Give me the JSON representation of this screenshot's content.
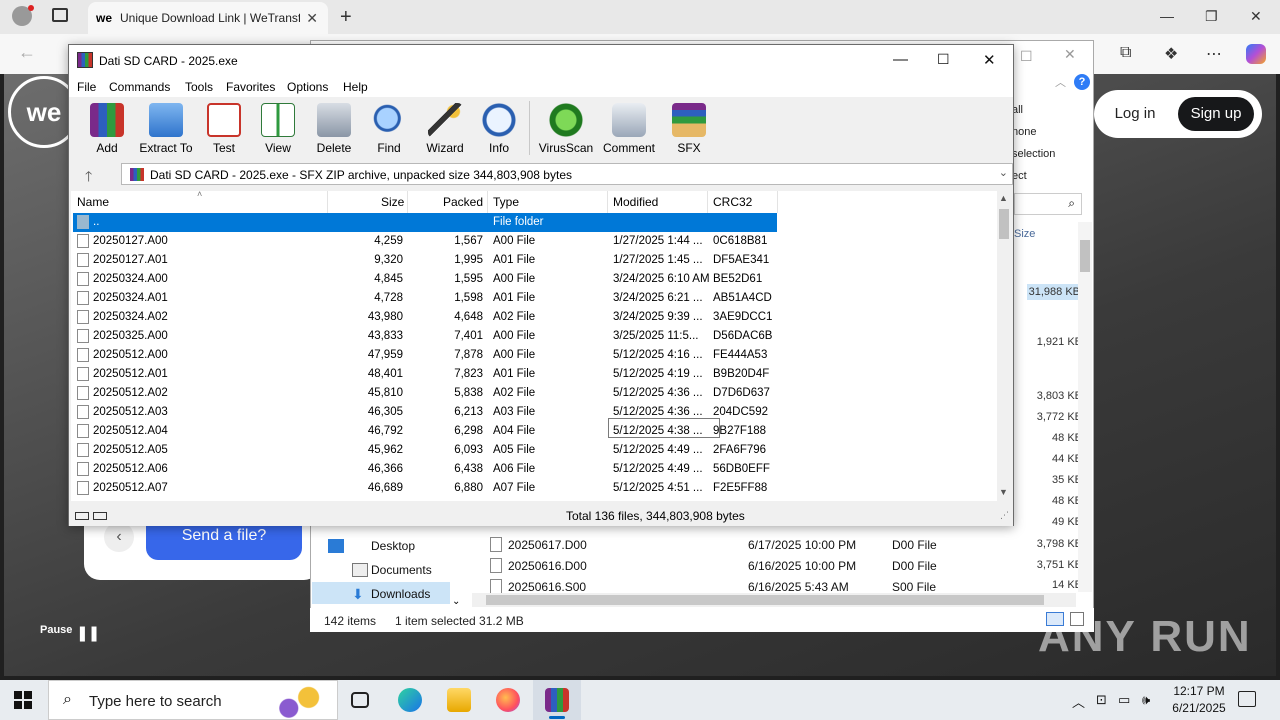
{
  "browser": {
    "tab_title": "Unique Download Link | WeTransf",
    "tab_favicon": "we",
    "new_tab": "+",
    "close_tab": "✕",
    "min": "—",
    "max": "❐",
    "close": "✕"
  },
  "website": {
    "logo": "we",
    "login": "Log in",
    "signup": "Sign up",
    "send_file": "Send a file?",
    "back": "‹",
    "pause": "Pause",
    "pause_icon": "❚❚",
    "watermark": "ANY RUN"
  },
  "explorer": {
    "right_labels": [
      "all",
      "none",
      "selection",
      "ect"
    ],
    "size_header": "Size",
    "sizes": [
      "31,988 KB",
      "1,921 KB",
      "3,803 KB",
      "3,772 KB",
      "48 KB",
      "44 KB",
      "35 KB",
      "48 KB",
      "49 KB",
      "3,798 KB",
      "3,751 KB",
      "14 KB"
    ],
    "nav": [
      "Desktop",
      "Documents",
      "Downloads"
    ],
    "files": [
      {
        "name": "20250617.D00",
        "modified": "6/17/2025 10:00 PM",
        "type": "D00 File"
      },
      {
        "name": "20250616.D00",
        "modified": "6/16/2025 10:00 PM",
        "type": "D00 File"
      },
      {
        "name": "20250616.S00",
        "modified": "6/16/2025 5:43 AM",
        "type": "S00 File"
      }
    ],
    "status_items": "142 items",
    "status_selected": "1 item selected  31.2 MB"
  },
  "winrar": {
    "title": "Dati SD CARD - 2025.exe",
    "menu": [
      "File",
      "Commands",
      "Tools",
      "Favorites",
      "Options",
      "Help"
    ],
    "tools": [
      "Add",
      "Extract To",
      "Test",
      "View",
      "Delete",
      "Find",
      "Wizard",
      "Info",
      "VirusScan",
      "Comment",
      "SFX"
    ],
    "path": "Dati SD CARD - 2025.exe - SFX ZIP archive, unpacked size 344,803,908 bytes",
    "columns": [
      "Name",
      "Size",
      "Packed",
      "Type",
      "Modified",
      "CRC32"
    ],
    "parent_row": {
      "name": "..",
      "type": "File folder"
    },
    "rows": [
      {
        "name": "20250127.A00",
        "size": "4,259",
        "packed": "1,567",
        "type": "A00 File",
        "modified": "1/27/2025 1:44 ...",
        "crc": "0C618B81"
      },
      {
        "name": "20250127.A01",
        "size": "9,320",
        "packed": "1,995",
        "type": "A01 File",
        "modified": "1/27/2025 1:45 ...",
        "crc": "DF5AE341"
      },
      {
        "name": "20250324.A00",
        "size": "4,845",
        "packed": "1,595",
        "type": "A00 File",
        "modified": "3/24/2025 6:10 AM",
        "crc": "BE52D61"
      },
      {
        "name": "20250324.A01",
        "size": "4,728",
        "packed": "1,598",
        "type": "A01 File",
        "modified": "3/24/2025 6:21 ...",
        "crc": "AB51A4CD"
      },
      {
        "name": "20250324.A02",
        "size": "43,980",
        "packed": "4,648",
        "type": "A02 File",
        "modified": "3/24/2025 9:39 ...",
        "crc": "3AE9DCC1"
      },
      {
        "name": "20250325.A00",
        "size": "43,833",
        "packed": "7,401",
        "type": "A00 File",
        "modified": "3/25/2025 11:5...",
        "crc": "D56DAC6B"
      },
      {
        "name": "20250512.A00",
        "size": "47,959",
        "packed": "7,878",
        "type": "A00 File",
        "modified": "5/12/2025 4:16 ...",
        "crc": "FE444A53"
      },
      {
        "name": "20250512.A01",
        "size": "48,401",
        "packed": "7,823",
        "type": "A01 File",
        "modified": "5/12/2025 4:19 ...",
        "crc": "B9B20D4F"
      },
      {
        "name": "20250512.A02",
        "size": "45,810",
        "packed": "5,838",
        "type": "A02 File",
        "modified": "5/12/2025 4:36 ...",
        "crc": "D7D6D637"
      },
      {
        "name": "20250512.A03",
        "size": "46,305",
        "packed": "6,213",
        "type": "A03 File",
        "modified": "5/12/2025 4:36 ...",
        "crc": "204DC592"
      },
      {
        "name": "20250512.A04",
        "size": "46,792",
        "packed": "6,298",
        "type": "A04 File",
        "modified": "5/12/2025 4:38 ...",
        "crc": "9B27F188"
      },
      {
        "name": "20250512.A05",
        "size": "45,962",
        "packed": "6,093",
        "type": "A05 File",
        "modified": "5/12/2025 4:49 ...",
        "crc": "2FA6F796"
      },
      {
        "name": "20250512.A06",
        "size": "46,366",
        "packed": "6,438",
        "type": "A06 File",
        "modified": "5/12/2025 4:49 ...",
        "crc": "56DB0EFF"
      },
      {
        "name": "20250512.A07",
        "size": "46,689",
        "packed": "6,880",
        "type": "A07 File",
        "modified": "5/12/2025 4:51 ...",
        "crc": "F2E5FF88"
      }
    ],
    "status": "Total 136 files, 344,803,908 bytes"
  },
  "taskbar": {
    "search": "Type here to search",
    "time": "12:17 PM",
    "date": "6/21/2025"
  },
  "colors": {
    "selection": "#0078d7",
    "accent": "#3767ea"
  }
}
